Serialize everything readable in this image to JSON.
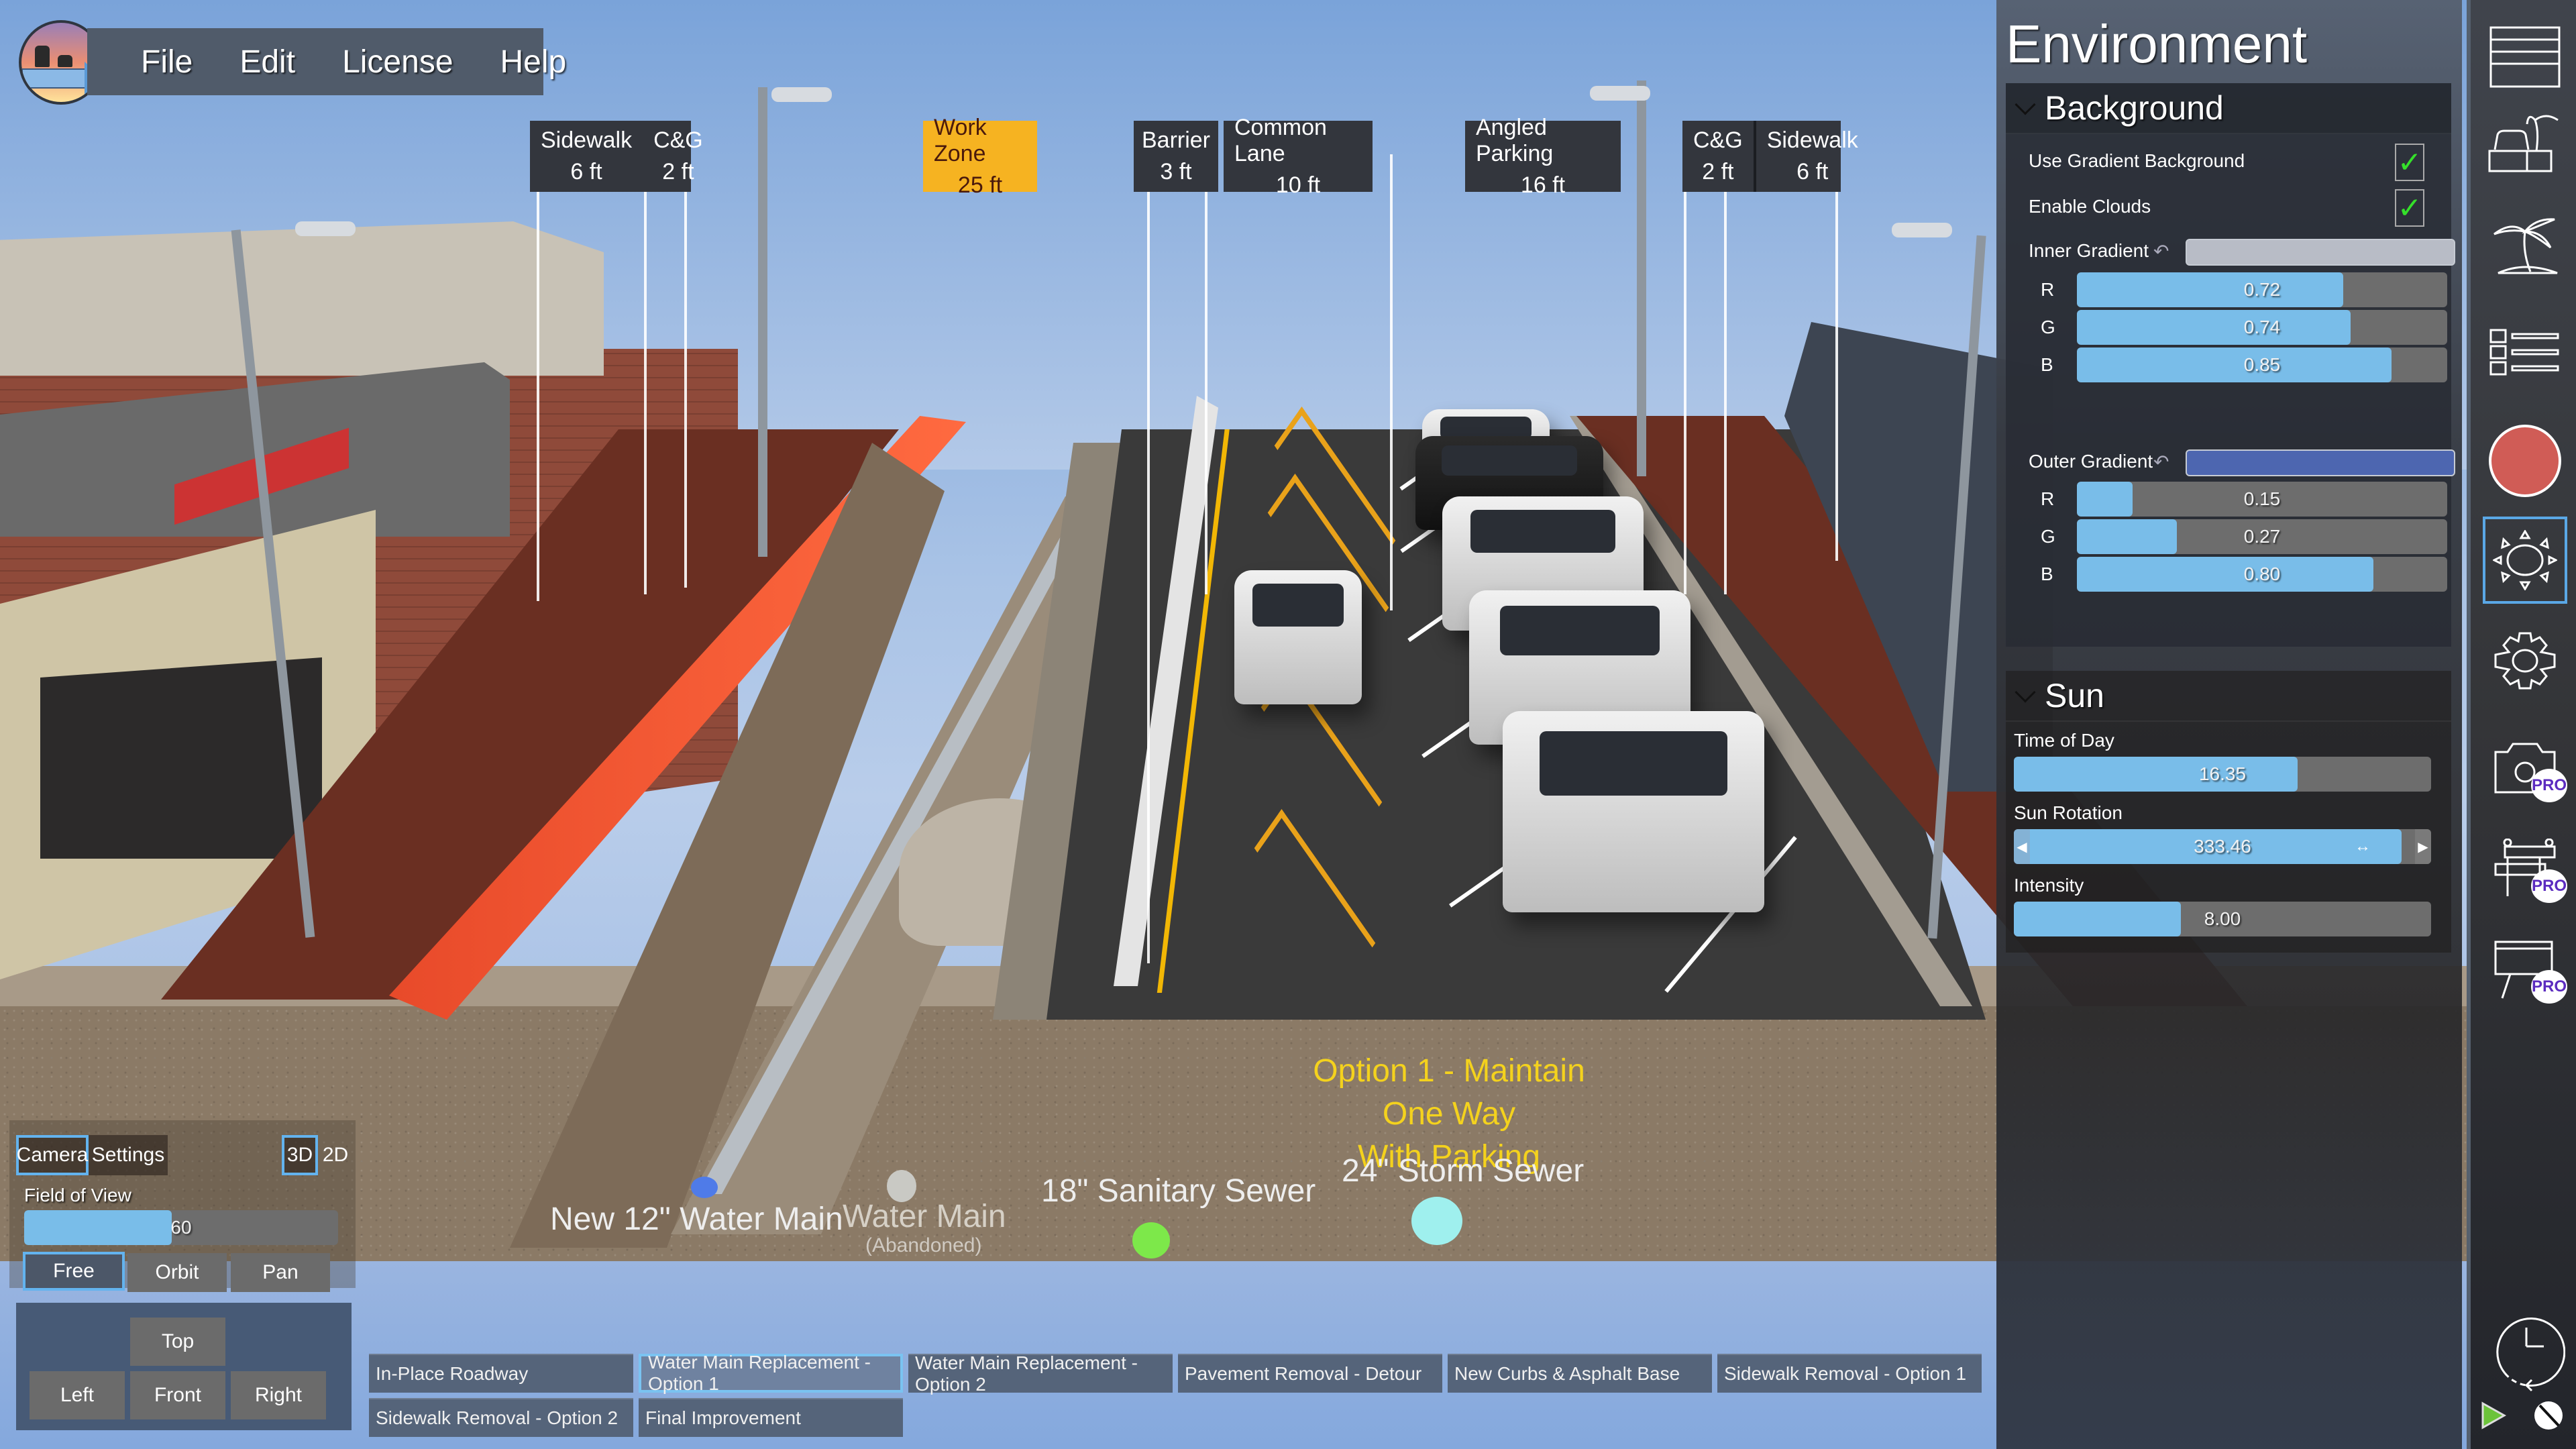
{
  "menu": {
    "logo": "app-logo",
    "items": [
      "File",
      "Edit",
      "License",
      "Help"
    ]
  },
  "dimension_labels": [
    {
      "cells": [
        {
          "name": "Sidewalk",
          "width": "6 ft"
        },
        {
          "name": "C&G",
          "width": "2 ft"
        }
      ]
    },
    {
      "cells": [
        {
          "name": "Work Zone",
          "width": "25 ft"
        }
      ],
      "highlight": true
    },
    {
      "cells": [
        {
          "name": "Barrier",
          "width": "3 ft"
        }
      ]
    },
    {
      "cells": [
        {
          "name": "Common Lane",
          "width": "10 ft"
        }
      ]
    },
    {
      "cells": [
        {
          "name": "Angled Parking",
          "width": "16 ft"
        }
      ]
    },
    {
      "cells": [
        {
          "name": "C&G",
          "width": "2 ft"
        },
        {
          "name": "Sidewalk",
          "width": "6 ft"
        }
      ]
    }
  ],
  "scene": {
    "option_caption_line1": "Option 1 - Maintain One Way",
    "option_caption_line2": "With Parking",
    "utilities": [
      {
        "label": "New 12\" Water Main",
        "color": "#4f7be8"
      },
      {
        "label": "Water Main",
        "sublabel": "(Abandoned)",
        "color": "#c9c9c4"
      },
      {
        "label": "18\" Sanitary Sewer",
        "color": "#7de84a"
      },
      {
        "label": "24\" Storm Sewer",
        "color": "#9ff0ee"
      }
    ]
  },
  "environment": {
    "title": "Environment",
    "background": {
      "title": "Background",
      "use_gradient_label": "Use Gradient Background",
      "use_gradient": true,
      "enable_clouds_label": "Enable Clouds",
      "enable_clouds": true,
      "inner_gradient": {
        "label": "Inner Gradient",
        "swatch": "#b8bcc6",
        "channels": [
          {
            "name": "R",
            "value": 0.72,
            "display": "0.72"
          },
          {
            "name": "G",
            "value": 0.74,
            "display": "0.74"
          },
          {
            "name": "B",
            "value": 0.85,
            "display": "0.85"
          }
        ]
      },
      "outer_gradient": {
        "label": "Outer Gradient",
        "swatch": "#4d66b0",
        "channels": [
          {
            "name": "R",
            "value": 0.15,
            "display": "0.15"
          },
          {
            "name": "G",
            "value": 0.27,
            "display": "0.27"
          },
          {
            "name": "B",
            "value": 0.8,
            "display": "0.80"
          }
        ]
      }
    },
    "sun": {
      "title": "Sun",
      "time_of_day_label": "Time of Day",
      "time_of_day": "16.35",
      "time_of_day_fraction": 0.68,
      "sun_rotation_label": "Sun Rotation",
      "sun_rotation": "333.46",
      "sun_rotation_fraction": 0.93,
      "intensity_label": "Intensity",
      "intensity": "8.00",
      "intensity_fraction": 0.4
    }
  },
  "toolbar": {
    "tools": [
      {
        "icon": "layers-icon",
        "pro": false
      },
      {
        "icon": "streetscape-icon",
        "pro": false
      },
      {
        "icon": "palm-tree-icon",
        "pro": false
      },
      {
        "icon": "checklist-icon",
        "pro": false
      },
      {
        "icon": "record-icon",
        "pro": false
      },
      {
        "icon": "sun-icon",
        "pro": false,
        "active": true
      },
      {
        "icon": "gear-icon",
        "pro": false
      },
      {
        "icon": "camera-settings-icon",
        "pro": true
      },
      {
        "icon": "road-barrier-icon",
        "pro": true
      },
      {
        "icon": "sign-board-icon",
        "pro": true
      }
    ],
    "pro_label": "PRO"
  },
  "camera": {
    "tabs": [
      "Camera",
      "Settings"
    ],
    "active_tab": "Camera",
    "modes": [
      "3D",
      "2D"
    ],
    "active_mode": "3D",
    "fov_label": "Field of View",
    "fov": "60",
    "fov_fraction": 0.47,
    "nav_buttons": [
      "Free",
      "Orbit",
      "Pan"
    ],
    "active_nav": "Free",
    "view_buttons": {
      "top": "Top",
      "left": "Left",
      "front": "Front",
      "right": "Right"
    }
  },
  "scenarios": [
    "In-Place Roadway",
    "Water Main Replacement - Option 1",
    "Water Main Replacement - Option 2",
    "Pavement Removal - Detour",
    "New Curbs & Asphalt Base",
    "Sidewalk Removal - Option 1",
    "Sidewalk Removal - Option 2",
    "Final Improvement"
  ],
  "active_scenario": "Water Main Replacement - Option 1"
}
